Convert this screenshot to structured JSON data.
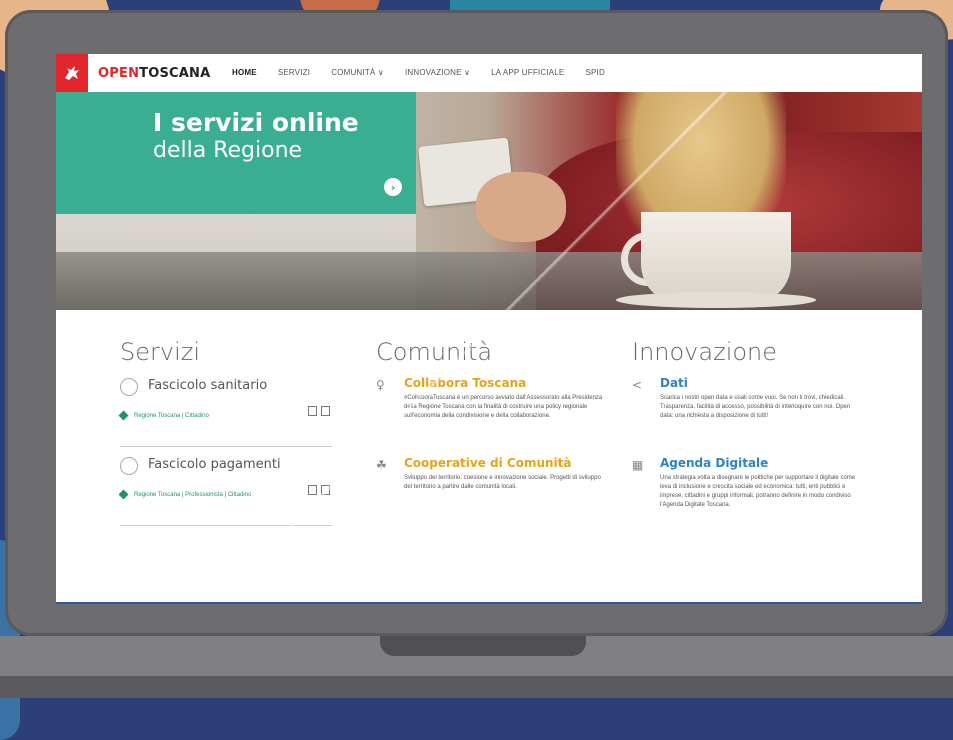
{
  "brand": {
    "prefix": "O",
    "mid": "PEN",
    "name": "TOSCANA",
    "accent_color": "#e0262b"
  },
  "nav": {
    "items": [
      {
        "label": "HOME",
        "active": true
      },
      {
        "label": "SERVIZI",
        "active": false
      },
      {
        "label": "COMUNITÀ ∨",
        "active": false
      },
      {
        "label": "INNOVAZIONE ∨",
        "active": false
      },
      {
        "label": "LA APP UFFICIALE",
        "active": false
      },
      {
        "label": "SPID",
        "active": false
      }
    ]
  },
  "hero": {
    "title": "I servizi online",
    "subtitle": "della Regione",
    "panel_color": "#2daa8c",
    "next_icon": "chevron-right-icon",
    "slides_count": 3,
    "active_slide": 1
  },
  "servizi": {
    "title": "Servizi",
    "items": [
      {
        "title": "Fascicolo sanitario",
        "tags": "Regione Toscana | Cittadino"
      },
      {
        "title": "Fascicolo pagamenti",
        "tags": "Regione Toscana | Professionista | Cittadino"
      }
    ]
  },
  "comunita": {
    "title": "Comunità",
    "items": [
      {
        "title": "Collabora Toscana",
        "icon": "lightbulb-icon",
        "text": "#CollaboraToscana è un percorso avviato dall'Assessorato alla Presidenza della Regione Toscana con la finalità di costruire una policy regionale sull'economia della condivisione e della collaborazione."
      },
      {
        "title": "Cooperative di Comunità",
        "icon": "cooperative-icon",
        "text": "Sviluppo del territorio: coesione e innovazione sociale. Progetti di sviluppo del territorio a partire dalle comunità locali."
      }
    ]
  },
  "innovazione": {
    "title": "Innovazione",
    "items": [
      {
        "title": "Dati",
        "icon": "share-icon",
        "text": "Scarica i nostri open data e usali come vuoi. Se non li trovi, chiedicali. Trasparenza, facilità di accesso, possibilità di interloquire con noi. Open data: una richiesta a disposizione di tutti!"
      },
      {
        "title": "Agenda Digitale",
        "icon": "calendar-icon",
        "text": "Una strategia volta a disegnare le politiche per supportare il digitale come leva di inclusione e crescita sociale ed economica: tutti, enti pubblici e imprese, cittadini e gruppi informali, potranno definire in modo condiviso l'Agenda Digitale Toscana."
      }
    ]
  }
}
